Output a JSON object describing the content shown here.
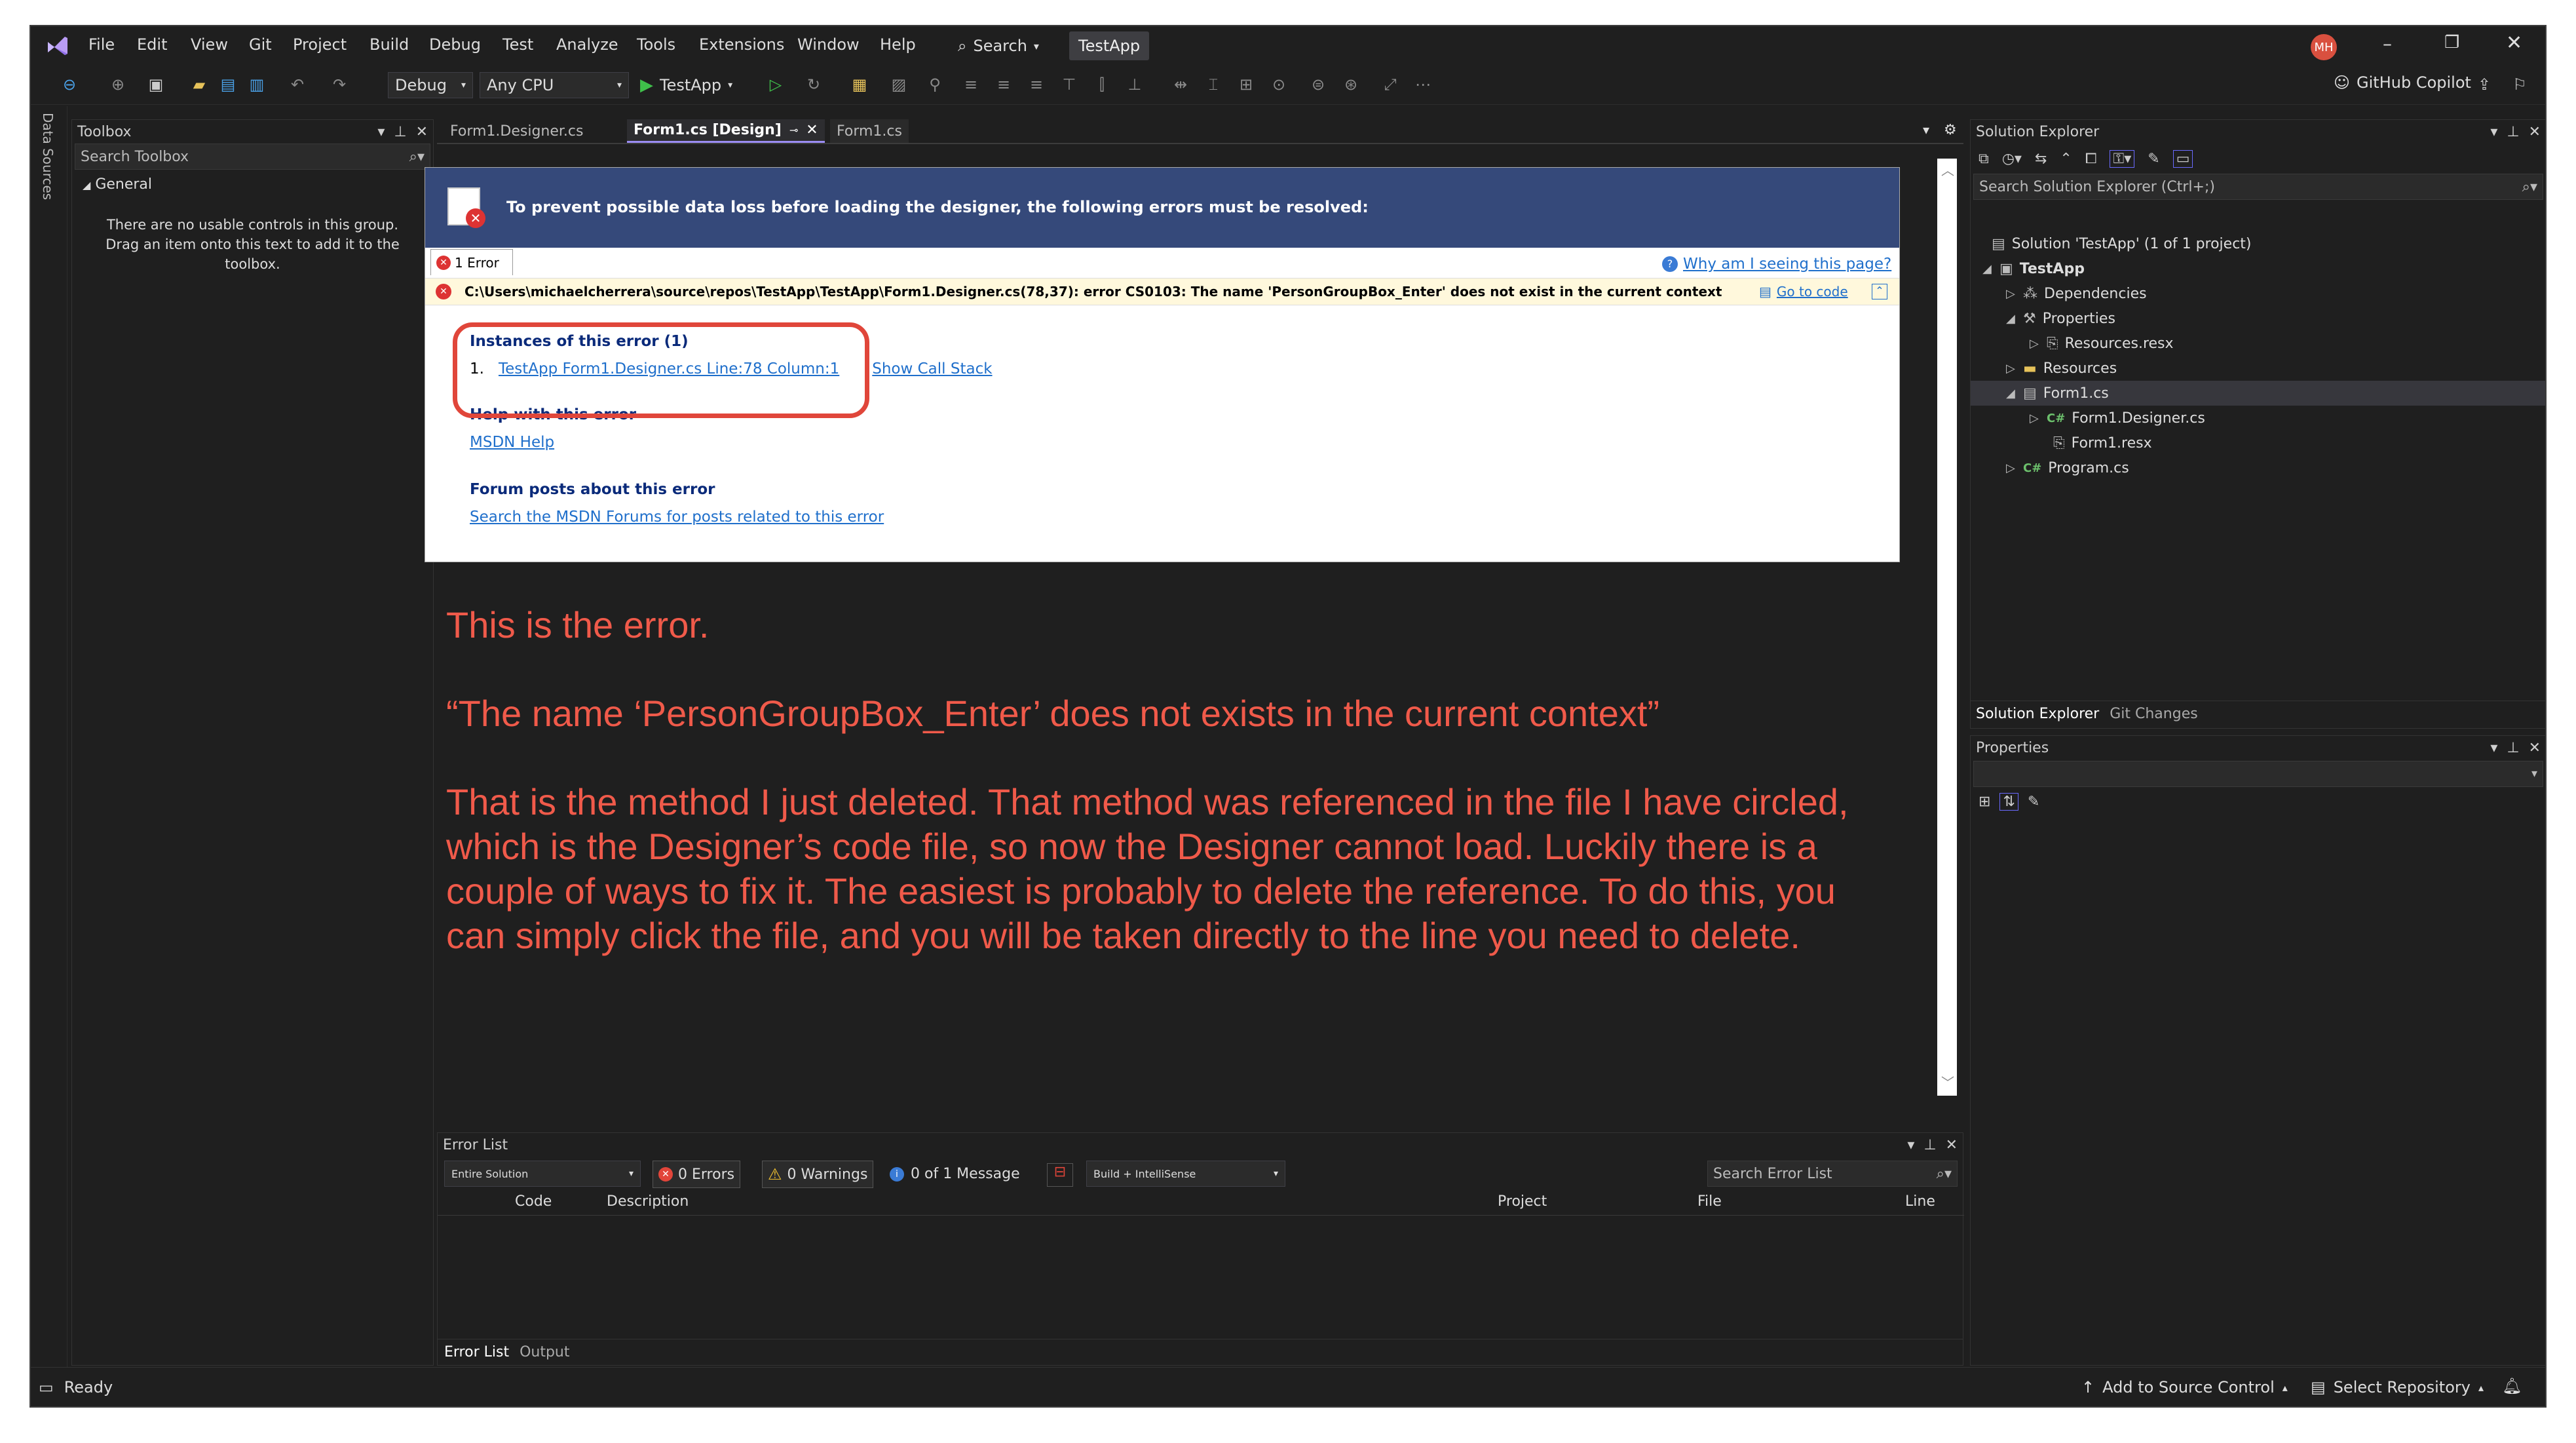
{
  "titlebar": {
    "menu": [
      "File",
      "Edit",
      "View",
      "Git",
      "Project",
      "Build",
      "Debug",
      "Test",
      "Analyze",
      "Tools",
      "Extensions",
      "Window",
      "Help"
    ],
    "search_label": "Search",
    "app_name": "TestApp",
    "avatar_initials": "MH"
  },
  "toolbar": {
    "config": "Debug",
    "platform": "Any CPU",
    "run_label": "TestApp",
    "copilot_label": "GitHub Copilot"
  },
  "sidestrip": {
    "label": "Data Sources"
  },
  "toolbox": {
    "title": "Toolbox",
    "search_placeholder": "Search Toolbox",
    "group": "General",
    "empty_text": "There are no usable controls in this group. Drag an item onto this text to add it to the toolbox."
  },
  "doc_tabs": [
    {
      "label": "Form1.Designer.cs"
    },
    {
      "label": "Form1.cs [Design]"
    },
    {
      "label": "Form1.cs"
    }
  ],
  "designer_error": {
    "headline": "To prevent possible data loss before loading the designer, the following errors must be resolved:",
    "tab_label": "1 Error",
    "why_link": "Why am I seeing this page?",
    "error_message": "C:\\Users\\michaelcherrera\\source\\repos\\TestApp\\TestApp\\Form1.Designer.cs(78,37): error CS0103: The name 'PersonGroupBox_Enter' does not exist in the current context",
    "goto_code": "Go to code",
    "instances_title": "Instances of this error (1)",
    "instance_number": "1.",
    "instance_link": "TestApp Form1.Designer.cs Line:78 Column:1",
    "show_call_stack": "Show Call Stack",
    "help_title": "Help with this error",
    "help_link": "MSDN Help",
    "forum_title": "Forum posts about this error",
    "forum_link": "Search the MSDN Forums for posts related to this error"
  },
  "annotation": {
    "line1": "This is the error.",
    "line2": "“The name ‘PersonGroupBox_Enter’ does not exists in the current context”",
    "para": [
      "That is the method I just deleted. That method was referenced in the file I have circled,",
      "which is the Designer’s code file, so now the Designer cannot load. Luckily there is a",
      "couple of ways to fix it. The easiest is probably to delete the reference. To do this, you",
      "can simply click the file, and you will be taken directly to the line you need to delete."
    ],
    "color": "#f05a4a"
  },
  "error_list": {
    "title": "Error List",
    "scope": "Entire Solution",
    "errors": "0 Errors",
    "warnings": "0 Warnings",
    "messages": "0 of 1 Message",
    "build_filter": "Build + IntelliSense",
    "search_placeholder": "Search Error List",
    "columns": [
      "Code",
      "Description",
      "Project",
      "File",
      "Line"
    ],
    "bottom_tabs": [
      "Error List",
      "Output"
    ]
  },
  "solution_explorer": {
    "title": "Solution Explorer",
    "search_placeholder": "Search Solution Explorer (Ctrl+;)",
    "items": [
      {
        "label": "Solution 'TestApp' (1 of 1 project)",
        "icon": "solution-icon"
      },
      {
        "label": "TestApp",
        "icon": "project-icon"
      },
      {
        "label": "Dependencies",
        "icon": "dependencies-icon"
      },
      {
        "label": "Properties",
        "icon": "properties-icon"
      },
      {
        "label": "Resources.resx",
        "icon": "resx-icon"
      },
      {
        "label": "Resources",
        "icon": "folder-icon"
      },
      {
        "label": "Form1.cs",
        "icon": "form-icon"
      },
      {
        "label": "Form1.Designer.cs",
        "icon": "csharp-icon"
      },
      {
        "label": "Form1.resx",
        "icon": "resx-icon"
      },
      {
        "label": "Program.cs",
        "icon": "csharp-icon"
      }
    ],
    "bottom_tabs": [
      "Solution Explorer",
      "Git Changes"
    ]
  },
  "properties": {
    "title": "Properties"
  },
  "statusbar": {
    "ready": "Ready",
    "add_source_control": "Add to Source Control",
    "select_repo": "Select Repository"
  }
}
